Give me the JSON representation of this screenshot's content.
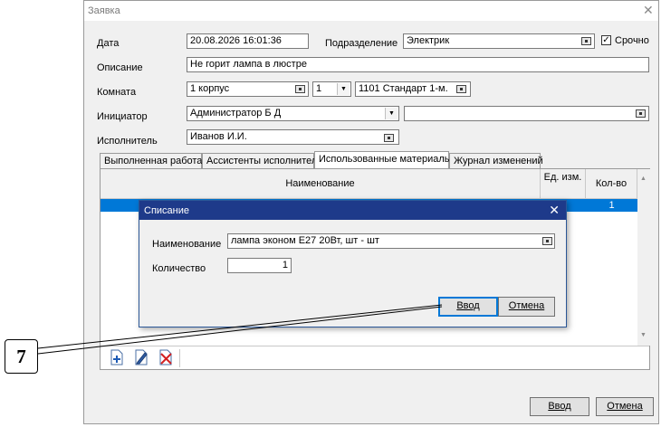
{
  "window": {
    "title": "Заявка"
  },
  "form": {
    "date_label": "Дата",
    "date_value": "20.08.2026 16:01:36",
    "division_label": "Подразделение",
    "division_value": "Электрик",
    "urgent_label": "Срочно",
    "urgent_checked": true,
    "description_label": "Описание",
    "description_value": "Не горит лампа в люстре",
    "room_label": "Комната",
    "room_building": "1 корпус",
    "room_floor": "1",
    "room_value": "1101  Стандарт 1-м.",
    "initiator_label": "Инициатор",
    "initiator_value": "Администратор Б Д",
    "initiator_extra": "",
    "executor_label": "Исполнитель",
    "executor_value": "Иванов И.И."
  },
  "tabs": [
    {
      "label": "Выполненная работа",
      "active": false
    },
    {
      "label": "Ассистенты исполнителя",
      "active": false
    },
    {
      "label": "Использованные материалы",
      "active": true
    },
    {
      "label": "Журнал изменений",
      "active": false
    }
  ],
  "grid": {
    "columns": [
      "Наименование",
      "Ед. изм.",
      "Кол-во"
    ],
    "rows": [
      {
        "name": "",
        "unit": "",
        "qty": "1",
        "selected": true
      }
    ]
  },
  "footer": {
    "ok_label": "Ввод",
    "cancel_label": "Отмена"
  },
  "dialog": {
    "title": "Списание",
    "name_label": "Наименование",
    "name_value": "лампа эконом Е27 20Вт, шт - шт",
    "qty_label": "Количество",
    "qty_value": "1",
    "ok_label": "Ввод",
    "cancel_label": "Отмена"
  },
  "callout": {
    "number": "7"
  },
  "icons": {
    "add": "add-row-icon",
    "edit": "edit-row-icon",
    "delete": "delete-row-icon"
  },
  "colors": {
    "accent": "#0078d7",
    "dialog_title": "#1e3a8a",
    "selection": "#0078d7"
  }
}
